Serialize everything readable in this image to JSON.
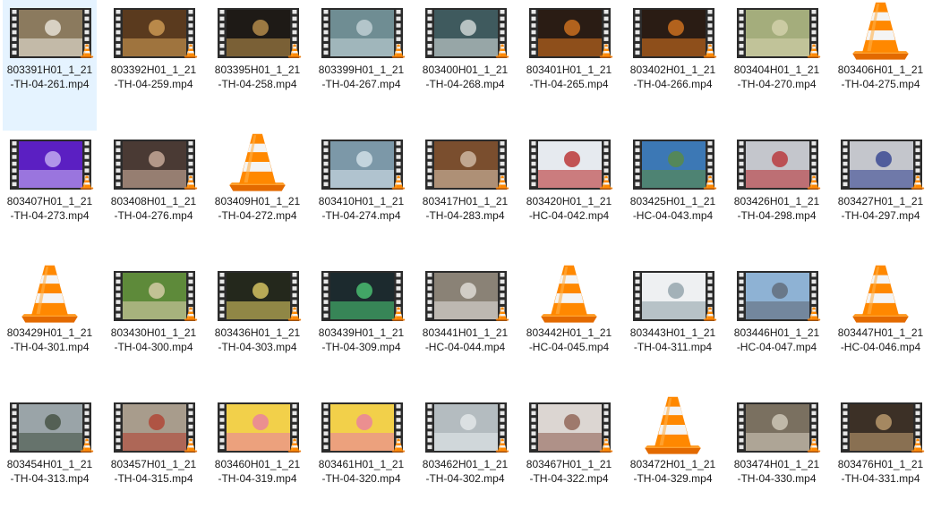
{
  "view": {
    "selected_index": 0
  },
  "files": [
    {
      "name": "803391H01_1_21-TH-04-261.mp4",
      "icon": "video-thumbnail-icon",
      "bg": "#8b7a5e",
      "accent": "#f2efe6"
    },
    {
      "name": "803392H01_1_21-TH-04-259.mp4",
      "icon": "video-thumbnail-icon",
      "bg": "#5a3a1e",
      "accent": "#d9a45a"
    },
    {
      "name": "803395H01_1_21-TH-04-258.mp4",
      "icon": "video-thumbnail-icon",
      "bg": "#1e1a16",
      "accent": "#c79a52"
    },
    {
      "name": "803399H01_1_21-TH-04-267.mp4",
      "icon": "video-thumbnail-icon",
      "bg": "#6f8d93",
      "accent": "#c9d8dc"
    },
    {
      "name": "803400H01_1_21-TH-04-268.mp4",
      "icon": "video-thumbnail-icon",
      "bg": "#3f5a5e",
      "accent": "#e0e6e4"
    },
    {
      "name": "803401H01_1_21-TH-04-265.mp4",
      "icon": "video-thumbnail-icon",
      "bg": "#2a1c14",
      "accent": "#e07a20"
    },
    {
      "name": "803402H01_1_21-TH-04-266.mp4",
      "icon": "video-thumbnail-icon",
      "bg": "#2a1c14",
      "accent": "#e07a20"
    },
    {
      "name": "803404H01_1_21-TH-04-270.mp4",
      "icon": "video-thumbnail-icon",
      "bg": "#a4ad7c",
      "accent": "#d8d6b0"
    },
    {
      "name": "803406H01_1_21-TH-04-275.mp4",
      "icon": "vlc-cone-icon"
    },
    {
      "name": "803407H01_1_21-TH-04-273.mp4",
      "icon": "video-thumbnail-icon",
      "bg": "#5b1fc2",
      "accent": "#cdbcf5"
    },
    {
      "name": "803408H01_1_21-TH-04-276.mp4",
      "icon": "video-thumbnail-icon",
      "bg": "#4a3a34",
      "accent": "#d6b7a4"
    },
    {
      "name": "803409H01_1_21-TH-04-272.mp4",
      "icon": "vlc-cone-icon"
    },
    {
      "name": "803410H01_1_21-TH-04-274.mp4",
      "icon": "video-thumbnail-icon",
      "bg": "#7c98a8",
      "accent": "#dbe8ef"
    },
    {
      "name": "803417H01_1_21-TH-04-283.mp4",
      "icon": "video-thumbnail-icon",
      "bg": "#7a4e2e",
      "accent": "#d9c6b2"
    },
    {
      "name": "803420H01_1_21-HC-04-042.mp4",
      "icon": "video-thumbnail-icon",
      "bg": "#e6eaef",
      "accent": "#b52020"
    },
    {
      "name": "803425H01_1_21-HC-04-043.mp4",
      "icon": "video-thumbnail-icon",
      "bg": "#3c78b5",
      "accent": "#5c8c3c"
    },
    {
      "name": "803426H01_1_21-TH-04-298.mp4",
      "icon": "video-thumbnail-icon",
      "bg": "#c4c6cc",
      "accent": "#b8282c"
    },
    {
      "name": "803427H01_1_21-TH-04-297.mp4",
      "icon": "video-thumbnail-icon",
      "bg": "#c4c6cc",
      "accent": "#2a3a8c"
    },
    {
      "name": "803429H01_1_21-TH-04-301.mp4",
      "icon": "vlc-cone-icon"
    },
    {
      "name": "803430H01_1_21-TH-04-300.mp4",
      "icon": "video-thumbnail-icon",
      "bg": "#5e8a3a",
      "accent": "#e4d4b4"
    },
    {
      "name": "803436H01_1_21-TH-04-303.mp4",
      "icon": "video-thumbnail-icon",
      "bg": "#24281c",
      "accent": "#e9d56a"
    },
    {
      "name": "803439H01_1_21-TH-04-309.mp4",
      "icon": "video-thumbnail-icon",
      "bg": "#1c2a2e",
      "accent": "#4fd07a"
    },
    {
      "name": "803441H01_1_21-HC-04-044.mp4",
      "icon": "video-thumbnail-icon",
      "bg": "#8a8276",
      "accent": "#e8e6e2"
    },
    {
      "name": "803442H01_1_21-HC-04-045.mp4",
      "icon": "vlc-cone-icon"
    },
    {
      "name": "803443H01_1_21-TH-04-311.mp4",
      "icon": "video-thumbnail-icon",
      "bg": "#eef0f2",
      "accent": "#8a9ca4"
    },
    {
      "name": "803446H01_1_21-HC-04-047.mp4",
      "icon": "video-thumbnail-icon",
      "bg": "#8eb2d4",
      "accent": "#5c6470"
    },
    {
      "name": "803447H01_1_21-HC-04-046.mp4",
      "icon": "vlc-cone-icon"
    },
    {
      "name": "803454H01_1_21-TH-04-313.mp4",
      "icon": "video-thumbnail-icon",
      "bg": "#9aa4a8",
      "accent": "#3c4a3a"
    },
    {
      "name": "803457H01_1_21-TH-04-315.mp4",
      "icon": "video-thumbnail-icon",
      "bg": "#a89c8c",
      "accent": "#b23c2c"
    },
    {
      "name": "803460H01_1_21-TH-04-319.mp4",
      "icon": "video-thumbnail-icon",
      "bg": "#f2d04a",
      "accent": "#e87aa8"
    },
    {
      "name": "803461H01_1_21-TH-04-320.mp4",
      "icon": "video-thumbnail-icon",
      "bg": "#f2d04a",
      "accent": "#e87aa8"
    },
    {
      "name": "803462H01_1_21-TH-04-302.mp4",
      "icon": "video-thumbnail-icon",
      "bg": "#b4bcc0",
      "accent": "#e8ecee"
    },
    {
      "name": "803467H01_1_21-TH-04-322.mp4",
      "icon": "video-thumbnail-icon",
      "bg": "#dcd6d2",
      "accent": "#8a5a4a"
    },
    {
      "name": "803472H01_1_21-TH-04-329.mp4",
      "icon": "vlc-cone-icon"
    },
    {
      "name": "803474H01_1_21-TH-04-330.mp4",
      "icon": "video-thumbnail-icon",
      "bg": "#7a7060",
      "accent": "#d8d2c2"
    },
    {
      "name": "803476H01_1_21-TH-04-331.mp4",
      "icon": "video-thumbnail-icon",
      "bg": "#3c3026",
      "accent": "#c8a676"
    }
  ]
}
